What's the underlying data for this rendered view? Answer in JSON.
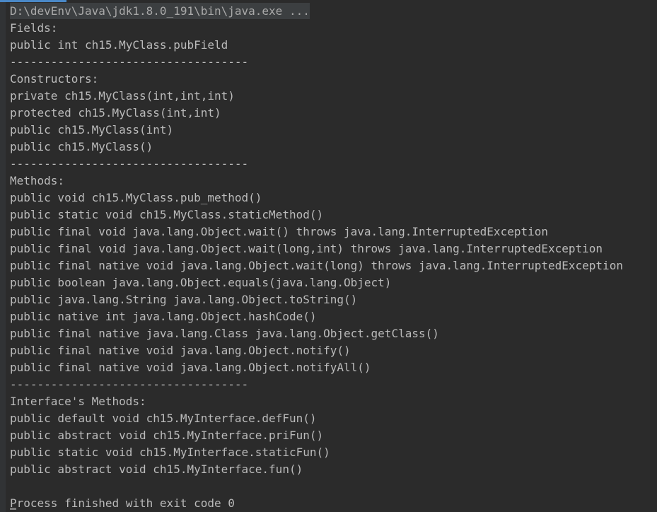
{
  "window": {
    "title": "Run Console Output",
    "background_color": "#2b2b2b",
    "text_color": "#bbbbbb",
    "accent_color": "#4a88c7",
    "highlight_background": "#3c3f41"
  },
  "console": {
    "command_line": "D:\\devEnv\\Java\\jdk1.8.0_191\\bin\\java.exe ...",
    "separator": "-----------------------------------",
    "sections": {
      "fields_header": "Fields:",
      "constructors_header": "Constructors:",
      "methods_header": "Methods:",
      "interface_methods_header": "Interface's Methods:"
    },
    "lines": [
      {
        "kind": "cmd",
        "text": "D:\\devEnv\\Java\\jdk1.8.0_191\\bin\\java.exe ..."
      },
      {
        "kind": "text",
        "text": "Fields:"
      },
      {
        "kind": "text",
        "text": "public int ch15.MyClass.pubField"
      },
      {
        "kind": "sep",
        "text": "-----------------------------------"
      },
      {
        "kind": "text",
        "text": "Constructors:"
      },
      {
        "kind": "text",
        "text": "private ch15.MyClass(int,int,int)"
      },
      {
        "kind": "text",
        "text": "protected ch15.MyClass(int,int)"
      },
      {
        "kind": "text",
        "text": "public ch15.MyClass(int)"
      },
      {
        "kind": "text",
        "text": "public ch15.MyClass()"
      },
      {
        "kind": "sep",
        "text": "-----------------------------------"
      },
      {
        "kind": "text",
        "text": "Methods:"
      },
      {
        "kind": "text",
        "text": "public void ch15.MyClass.pub_method()"
      },
      {
        "kind": "text",
        "text": "public static void ch15.MyClass.staticMethod()"
      },
      {
        "kind": "text",
        "text": "public final void java.lang.Object.wait() throws java.lang.InterruptedException"
      },
      {
        "kind": "text",
        "text": "public final void java.lang.Object.wait(long,int) throws java.lang.InterruptedException"
      },
      {
        "kind": "text",
        "text": "public final native void java.lang.Object.wait(long) throws java.lang.InterruptedException"
      },
      {
        "kind": "text",
        "text": "public boolean java.lang.Object.equals(java.lang.Object)"
      },
      {
        "kind": "text",
        "text": "public java.lang.String java.lang.Object.toString()"
      },
      {
        "kind": "text",
        "text": "public native int java.lang.Object.hashCode()"
      },
      {
        "kind": "text",
        "text": "public final native java.lang.Class java.lang.Object.getClass()"
      },
      {
        "kind": "text",
        "text": "public final native void java.lang.Object.notify()"
      },
      {
        "kind": "text",
        "text": "public final native void java.lang.Object.notifyAll()"
      },
      {
        "kind": "sep",
        "text": "-----------------------------------"
      },
      {
        "kind": "text",
        "text": "Interface's Methods:"
      },
      {
        "kind": "text",
        "text": "public default void ch15.MyInterface.defFun()"
      },
      {
        "kind": "text",
        "text": "public abstract void ch15.MyInterface.priFun()"
      },
      {
        "kind": "text",
        "text": "public static void ch15.MyInterface.staticFun()"
      },
      {
        "kind": "text",
        "text": "public abstract void ch15.MyInterface.fun()"
      },
      {
        "kind": "blank",
        "text": " "
      },
      {
        "kind": "status",
        "text": "Process finished with exit code 0"
      }
    ],
    "exit_status": "Process finished with exit code 0",
    "exit_code": "0"
  }
}
